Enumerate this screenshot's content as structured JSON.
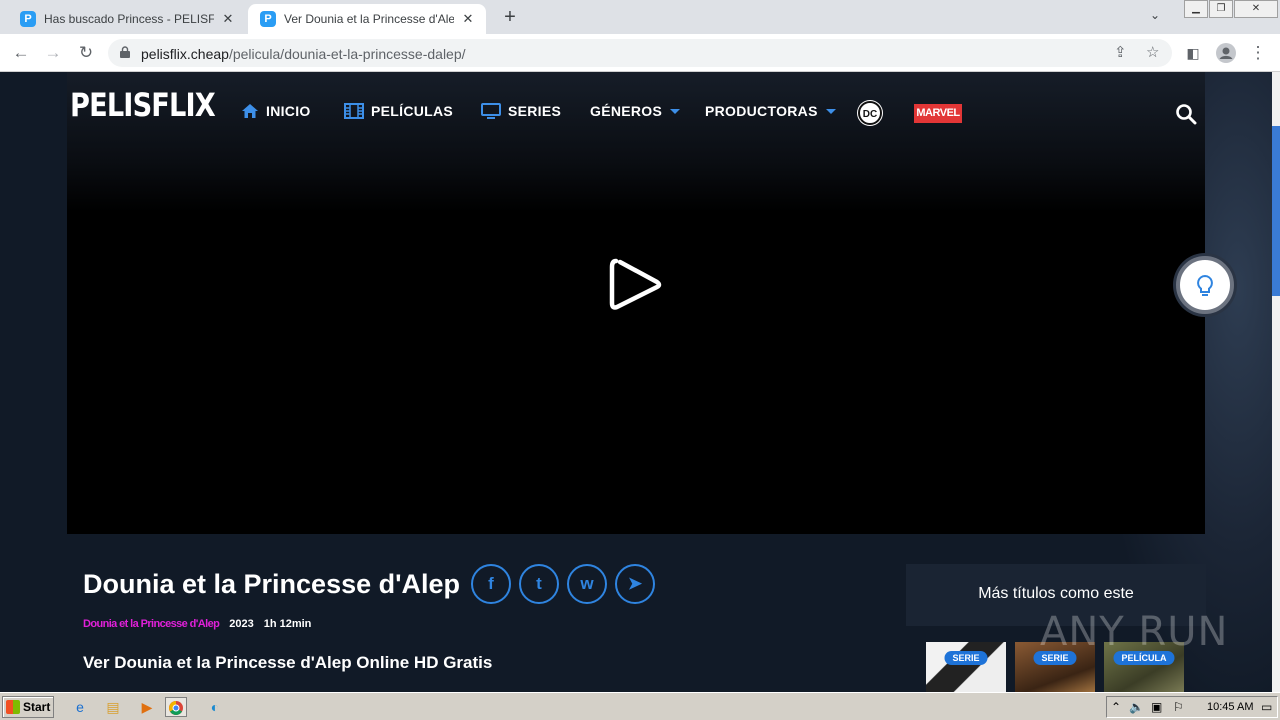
{
  "browser": {
    "tabs": [
      {
        "title": "Has buscado Princess - PELISFLIX [",
        "favicon": "P",
        "active": false
      },
      {
        "title": "Ver Dounia et la Princesse d'Alep Onl",
        "favicon": "P",
        "active": true
      }
    ],
    "new_tab": "+",
    "tab_search": "⌄",
    "url_domain": "pelisflix.cheap",
    "url_path": "/pelicula/dounia-et-la-princesse-dalep/"
  },
  "site": {
    "logo": "PELISFLIX",
    "nav": [
      {
        "label": "INICIO",
        "icon": "home-icon"
      },
      {
        "label": "PELÍCULAS",
        "icon": "film-icon"
      },
      {
        "label": "SERIES",
        "icon": "tv-icon"
      },
      {
        "label": "GÉNEROS",
        "icon": "caret-down-icon"
      },
      {
        "label": "PRODUCTORAS",
        "icon": "caret-down-icon"
      }
    ],
    "dc_label": "DC",
    "marvel_label": "MARVEL",
    "accent": "#3d8fe8"
  },
  "movie": {
    "title": "Dounia et la Princesse d'Alep",
    "category": "Dounia et la Princesse d'Alep",
    "year": "2023",
    "duration": "1h 12min",
    "subtitle": "Ver Dounia et la Princesse d'Alep Online HD Gratis",
    "share": [
      {
        "name": "facebook-icon",
        "glyph": "f"
      },
      {
        "name": "twitter-icon",
        "glyph": "t"
      },
      {
        "name": "whatsapp-icon",
        "glyph": "w"
      },
      {
        "name": "telegram-icon",
        "glyph": "➤"
      }
    ]
  },
  "sidebar": {
    "heading": "Más títulos como este",
    "posters": [
      {
        "badge": "SERIE",
        "color": "#e8e8e8"
      },
      {
        "badge": "SERIE",
        "color": "#6b4a2e"
      },
      {
        "badge": "PELÍCULA",
        "color": "#5a5f3a"
      }
    ]
  },
  "watermark": "ANY RUN",
  "taskbar": {
    "start": "Start",
    "clock": "10:45 AM"
  }
}
